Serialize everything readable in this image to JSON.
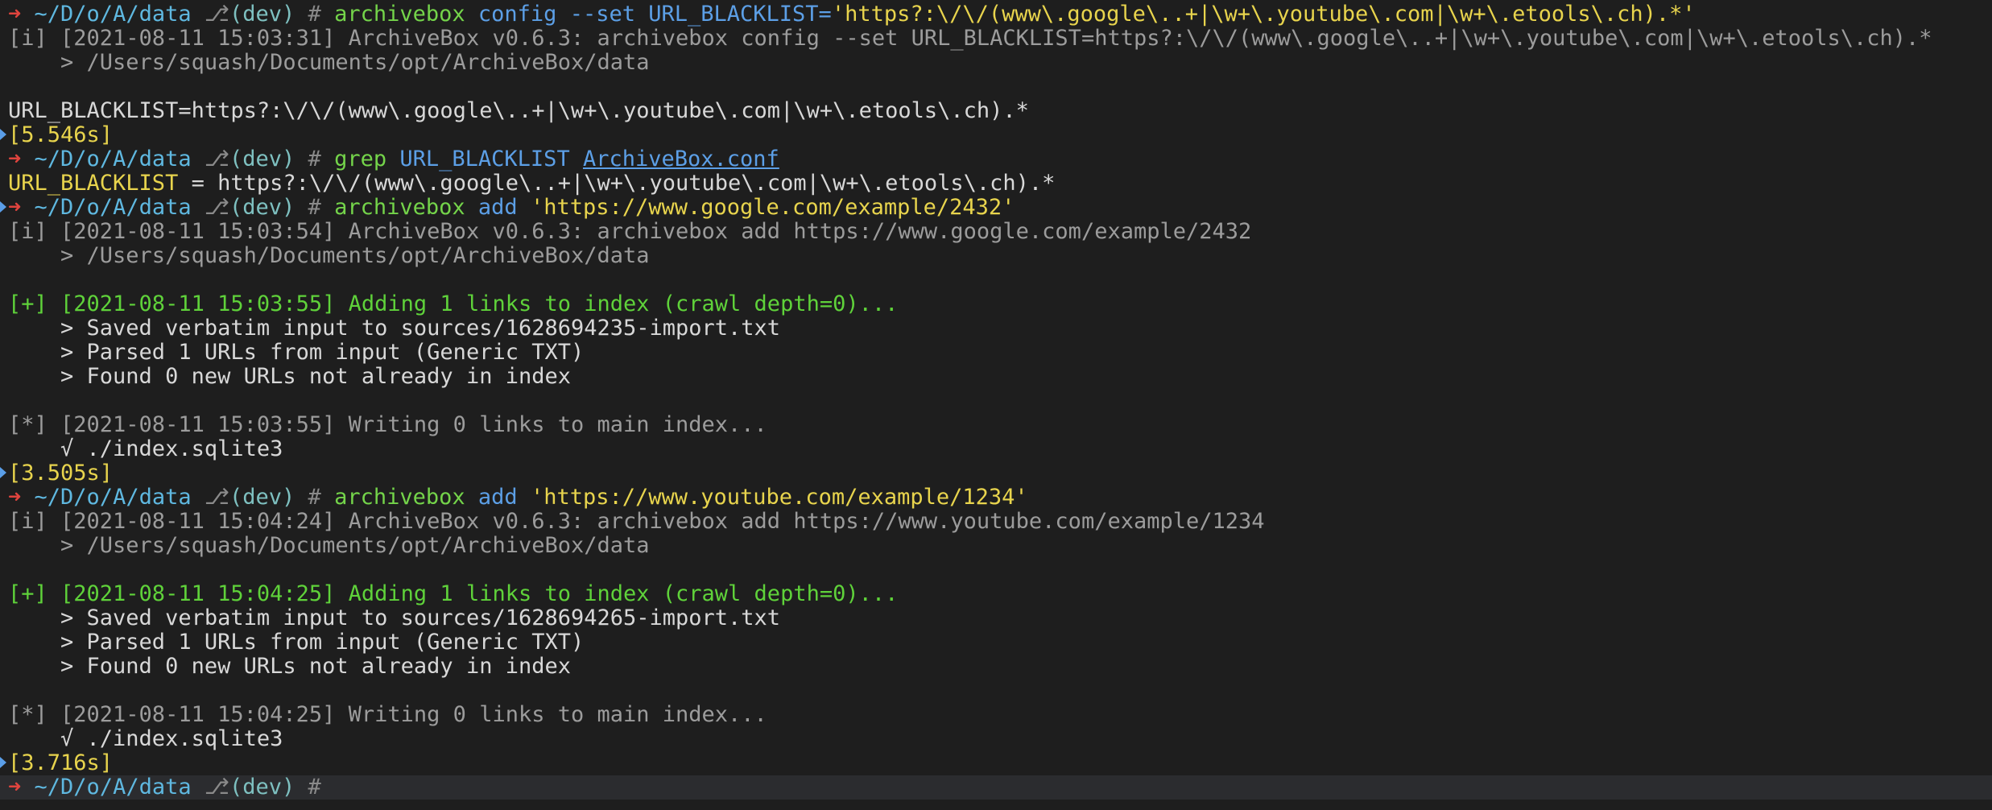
{
  "colors": {
    "background": "#1e1e1e",
    "prompt_arrow": "#e0443e",
    "path": "#5fb8e0",
    "command": "#74d44a",
    "argument": "#5c9fe6",
    "string": "#e8d44d",
    "success": "#5fd23a",
    "info": "#9c9c9c",
    "timing": "#e8d44d",
    "cursor_line": "#2b2c2f"
  },
  "prompt": {
    "arrow": "➜",
    "path": "~/D/o/A/data",
    "branch_icon": "⎇",
    "branch": "(dev)",
    "hash": "#"
  },
  "session": [
    {
      "command": "archivebox",
      "args": "config --set URL_BLACKLIST=",
      "string": "'https?:\\/\\/(www\\.google\\..+|\\w+\\.youtube\\.com|\\w+\\.etools\\.ch).*'",
      "output": [
        "[i] [2021-08-11 15:03:31] ArchiveBox v0.6.3: archivebox config --set URL_BLACKLIST=https?:\\/\\/(www\\.google\\..+|\\w+\\.youtube\\.com|\\w+\\.etools\\.ch).*",
        "    > /Users/squash/Documents/opt/ArchiveBox/data",
        "",
        "URL_BLACKLIST=https?:\\/\\/(www\\.google\\..+|\\w+\\.youtube\\.com|\\w+\\.etools\\.ch).*"
      ],
      "timing": "[5.546s]"
    },
    {
      "command": "grep",
      "args": "URL_BLACKLIST",
      "file": "ArchiveBox.conf",
      "result_key": "URL_BLACKLIST",
      "result_value": " = https?:\\/\\/(www\\.google\\..+|\\w+\\.youtube\\.com|\\w+\\.etools\\.ch).*"
    },
    {
      "command": "archivebox",
      "args": "add",
      "string": "'https://www.google.com/example/2432'",
      "info": [
        "[i] [2021-08-11 15:03:54] ArchiveBox v0.6.3: archivebox add https://www.google.com/example/2432",
        "    > /Users/squash/Documents/opt/ArchiveBox/data"
      ],
      "adding": "[+] [2021-08-11 15:03:55] Adding 1 links to index (crawl depth=0)...",
      "steps": [
        "    > Saved verbatim input to sources/1628694235-import.txt",
        "    > Parsed 1 URLs from input (Generic TXT)",
        "    > Found 0 new URLs not already in index"
      ],
      "writing": "[*] [2021-08-11 15:03:55] Writing 0 links to main index...",
      "done": "    √ ./index.sqlite3",
      "timing": "[3.505s]"
    },
    {
      "command": "archivebox",
      "args": "add",
      "string": "'https://www.youtube.com/example/1234'",
      "info": [
        "[i] [2021-08-11 15:04:24] ArchiveBox v0.6.3: archivebox add https://www.youtube.com/example/1234",
        "    > /Users/squash/Documents/opt/ArchiveBox/data"
      ],
      "adding": "[+] [2021-08-11 15:04:25] Adding 1 links to index (crawl depth=0)...",
      "steps": [
        "    > Saved verbatim input to sources/1628694265-import.txt",
        "    > Parsed 1 URLs from input (Generic TXT)",
        "    > Found 0 new URLs not already in index"
      ],
      "writing": "[*] [2021-08-11 15:04:25] Writing 0 links to main index...",
      "done": "    √ ./index.sqlite3",
      "timing": "[3.716s]"
    }
  ]
}
